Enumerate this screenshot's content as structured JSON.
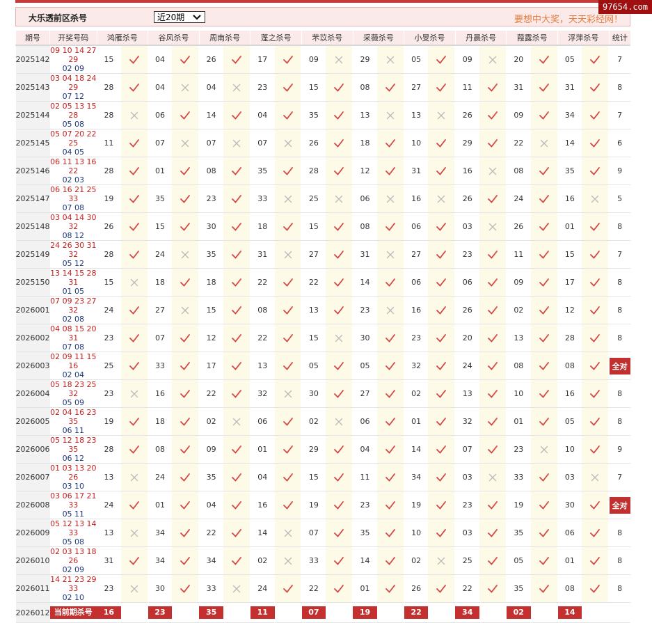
{
  "site": {
    "watermark": "97654.com"
  },
  "header": {
    "title": "大乐透前区杀号",
    "period_selected": "近20期",
    "slogan": "要想中大奖，天天彩经网！"
  },
  "columns": {
    "issue": "期号",
    "draw": "开奖号码",
    "experts": [
      "鸿雁杀号",
      "谷风杀号",
      "周南杀号",
      "蓬之杀号",
      "芣苡杀号",
      "采薇杀号",
      "小旻杀号",
      "丹晨杀号",
      "葭露杀号",
      "浮萍杀号"
    ],
    "total": "统计"
  },
  "rows": [
    {
      "issue": "2025142",
      "front": "09 10 14 27 29",
      "back": "02 09",
      "picks": [
        [
          "15",
          1
        ],
        [
          "04",
          1
        ],
        [
          "26",
          1
        ],
        [
          "17",
          1
        ],
        [
          "09",
          0
        ],
        [
          "29",
          0
        ],
        [
          "05",
          1
        ],
        [
          "09",
          0
        ],
        [
          "20",
          1
        ],
        [
          "05",
          1
        ]
      ],
      "total": "7"
    },
    {
      "issue": "2025143",
      "front": "03 04 18 24 29",
      "back": "07 12",
      "picks": [
        [
          "28",
          1
        ],
        [
          "04",
          0
        ],
        [
          "04",
          0
        ],
        [
          "23",
          1
        ],
        [
          "15",
          1
        ],
        [
          "08",
          1
        ],
        [
          "27",
          1
        ],
        [
          "11",
          1
        ],
        [
          "31",
          1
        ],
        [
          "31",
          1
        ]
      ],
      "total": "8"
    },
    {
      "issue": "2025144",
      "front": "02 05 13 15 28",
      "back": "05 08",
      "picks": [
        [
          "28",
          0
        ],
        [
          "06",
          1
        ],
        [
          "14",
          1
        ],
        [
          "04",
          1
        ],
        [
          "35",
          1
        ],
        [
          "13",
          0
        ],
        [
          "13",
          0
        ],
        [
          "26",
          1
        ],
        [
          "09",
          1
        ],
        [
          "34",
          1
        ]
      ],
      "total": "7"
    },
    {
      "issue": "2025145",
      "front": "05 07 20 22 25",
      "back": "04 05",
      "picks": [
        [
          "11",
          1
        ],
        [
          "07",
          0
        ],
        [
          "07",
          0
        ],
        [
          "07",
          0
        ],
        [
          "26",
          1
        ],
        [
          "18",
          1
        ],
        [
          "10",
          1
        ],
        [
          "29",
          1
        ],
        [
          "22",
          0
        ],
        [
          "14",
          1
        ]
      ],
      "total": "6"
    },
    {
      "issue": "2025146",
      "front": "06 11 13 16 22",
      "back": "02 03",
      "picks": [
        [
          "28",
          1
        ],
        [
          "01",
          1
        ],
        [
          "08",
          1
        ],
        [
          "35",
          1
        ],
        [
          "28",
          1
        ],
        [
          "12",
          1
        ],
        [
          "31",
          1
        ],
        [
          "16",
          0
        ],
        [
          "08",
          1
        ],
        [
          "35",
          1
        ]
      ],
      "total": "9"
    },
    {
      "issue": "2025147",
      "front": "06 16 21 25 33",
      "back": "07 08",
      "picks": [
        [
          "19",
          1
        ],
        [
          "35",
          1
        ],
        [
          "23",
          1
        ],
        [
          "33",
          0
        ],
        [
          "25",
          0
        ],
        [
          "06",
          0
        ],
        [
          "16",
          0
        ],
        [
          "26",
          1
        ],
        [
          "24",
          1
        ],
        [
          "16",
          0
        ]
      ],
      "total": "5"
    },
    {
      "issue": "2025148",
      "front": "03 04 14 30 32",
      "back": "08 12",
      "picks": [
        [
          "26",
          1
        ],
        [
          "15",
          1
        ],
        [
          "30",
          1
        ],
        [
          "18",
          1
        ],
        [
          "15",
          1
        ],
        [
          "08",
          1
        ],
        [
          "06",
          1
        ],
        [
          "03",
          0
        ],
        [
          "26",
          1
        ],
        [
          "01",
          1
        ]
      ],
      "total": "8"
    },
    {
      "issue": "2025149",
      "front": "24 26 30 31 32",
      "back": "05 12",
      "picks": [
        [
          "28",
          1
        ],
        [
          "24",
          0
        ],
        [
          "35",
          1
        ],
        [
          "31",
          0
        ],
        [
          "27",
          1
        ],
        [
          "31",
          0
        ],
        [
          "27",
          1
        ],
        [
          "23",
          1
        ],
        [
          "11",
          1
        ],
        [
          "15",
          1
        ]
      ],
      "total": "7"
    },
    {
      "issue": "2025150",
      "front": "13 14 15 28 31",
      "back": "01 05",
      "picks": [
        [
          "15",
          0
        ],
        [
          "18",
          1
        ],
        [
          "18",
          1
        ],
        [
          "22",
          1
        ],
        [
          "22",
          1
        ],
        [
          "14",
          1
        ],
        [
          "06",
          1
        ],
        [
          "06",
          1
        ],
        [
          "09",
          1
        ],
        [
          "17",
          1
        ]
      ],
      "total": "8"
    },
    {
      "issue": "2026001",
      "front": "07 09 23 27 32",
      "back": "02 08",
      "picks": [
        [
          "24",
          1
        ],
        [
          "27",
          0
        ],
        [
          "15",
          1
        ],
        [
          "08",
          1
        ],
        [
          "13",
          1
        ],
        [
          "23",
          0
        ],
        [
          "16",
          1
        ],
        [
          "26",
          1
        ],
        [
          "02",
          1
        ],
        [
          "12",
          1
        ]
      ],
      "total": "8"
    },
    {
      "issue": "2026002",
      "front": "04 08 15 20 31",
      "back": "07 08",
      "picks": [
        [
          "23",
          1
        ],
        [
          "07",
          1
        ],
        [
          "12",
          1
        ],
        [
          "22",
          1
        ],
        [
          "15",
          0
        ],
        [
          "30",
          1
        ],
        [
          "23",
          1
        ],
        [
          "20",
          1
        ],
        [
          "13",
          1
        ],
        [
          "28",
          1
        ]
      ],
      "total": "8"
    },
    {
      "issue": "2026003",
      "front": "02 09 11 15 16",
      "back": "02 04",
      "picks": [
        [
          "25",
          1
        ],
        [
          "33",
          1
        ],
        [
          "17",
          1
        ],
        [
          "13",
          1
        ],
        [
          "05",
          1
        ],
        [
          "05",
          1
        ],
        [
          "32",
          1
        ],
        [
          "24",
          1
        ],
        [
          "08",
          1
        ],
        [
          "08",
          1
        ]
      ],
      "total": "全对"
    },
    {
      "issue": "2026004",
      "front": "05 18 23 25 32",
      "back": "05 09",
      "picks": [
        [
          "23",
          0
        ],
        [
          "16",
          1
        ],
        [
          "22",
          1
        ],
        [
          "32",
          0
        ],
        [
          "30",
          1
        ],
        [
          "27",
          1
        ],
        [
          "02",
          1
        ],
        [
          "13",
          1
        ],
        [
          "10",
          1
        ],
        [
          "16",
          1
        ]
      ],
      "total": "8"
    },
    {
      "issue": "2026005",
      "front": "02 04 16 23 35",
      "back": "06 11",
      "picks": [
        [
          "19",
          1
        ],
        [
          "18",
          1
        ],
        [
          "02",
          0
        ],
        [
          "06",
          1
        ],
        [
          "02",
          0
        ],
        [
          "06",
          1
        ],
        [
          "01",
          1
        ],
        [
          "32",
          1
        ],
        [
          "01",
          1
        ],
        [
          "05",
          1
        ]
      ],
      "total": "8"
    },
    {
      "issue": "2026006",
      "front": "05 12 18 23 35",
      "back": "06 12",
      "picks": [
        [
          "28",
          1
        ],
        [
          "08",
          1
        ],
        [
          "09",
          1
        ],
        [
          "01",
          1
        ],
        [
          "29",
          1
        ],
        [
          "04",
          1
        ],
        [
          "14",
          1
        ],
        [
          "07",
          1
        ],
        [
          "23",
          0
        ],
        [
          "10",
          1
        ]
      ],
      "total": "9"
    },
    {
      "issue": "2026007",
      "front": "01 03 13 20 26",
      "back": "03 10",
      "picks": [
        [
          "13",
          0
        ],
        [
          "24",
          1
        ],
        [
          "35",
          1
        ],
        [
          "04",
          1
        ],
        [
          "15",
          1
        ],
        [
          "11",
          1
        ],
        [
          "34",
          1
        ],
        [
          "03",
          0
        ],
        [
          "33",
          1
        ],
        [
          "03",
          0
        ]
      ],
      "total": "7"
    },
    {
      "issue": "2026008",
      "front": "03 06 17 21 33",
      "back": "05 11",
      "picks": [
        [
          "24",
          1
        ],
        [
          "01",
          1
        ],
        [
          "04",
          1
        ],
        [
          "16",
          1
        ],
        [
          "19",
          1
        ],
        [
          "23",
          1
        ],
        [
          "19",
          1
        ],
        [
          "23",
          1
        ],
        [
          "19",
          1
        ],
        [
          "30",
          1
        ]
      ],
      "total": "全对"
    },
    {
      "issue": "2026009",
      "front": "05 12 13 14 33",
      "back": "05 08",
      "picks": [
        [
          "13",
          0
        ],
        [
          "34",
          1
        ],
        [
          "22",
          1
        ],
        [
          "14",
          0
        ],
        [
          "07",
          1
        ],
        [
          "35",
          1
        ],
        [
          "10",
          1
        ],
        [
          "03",
          1
        ],
        [
          "35",
          1
        ],
        [
          "06",
          1
        ]
      ],
      "total": "8"
    },
    {
      "issue": "2026010",
      "front": "02 03 13 18 26",
      "back": "02 09",
      "picks": [
        [
          "31",
          1
        ],
        [
          "34",
          1
        ],
        [
          "34",
          1
        ],
        [
          "02",
          0
        ],
        [
          "33",
          1
        ],
        [
          "14",
          1
        ],
        [
          "02",
          0
        ],
        [
          "25",
          1
        ],
        [
          "05",
          1
        ],
        [
          "01",
          1
        ]
      ],
      "total": "8"
    },
    {
      "issue": "2026011",
      "front": "14 21 23 29 33",
      "back": "02 10",
      "picks": [
        [
          "23",
          0
        ],
        [
          "30",
          1
        ],
        [
          "33",
          0
        ],
        [
          "24",
          1
        ],
        [
          "22",
          1
        ],
        [
          "01",
          1
        ],
        [
          "26",
          1
        ],
        [
          "22",
          1
        ],
        [
          "35",
          1
        ],
        [
          "08",
          1
        ]
      ],
      "total": "8"
    }
  ],
  "current": {
    "issue": "2026012",
    "label": "当前期杀号",
    "picks": [
      "16",
      "23",
      "35",
      "11",
      "07",
      "19",
      "22",
      "34",
      "02",
      "14"
    ]
  },
  "colors": {
    "accent": "#c4302f",
    "check": "#d64545",
    "cross": "#b8b8b8",
    "mark_bg": "#fdfbe8"
  },
  "icons": {
    "hit": "check-icon",
    "miss": "cross-icon"
  }
}
